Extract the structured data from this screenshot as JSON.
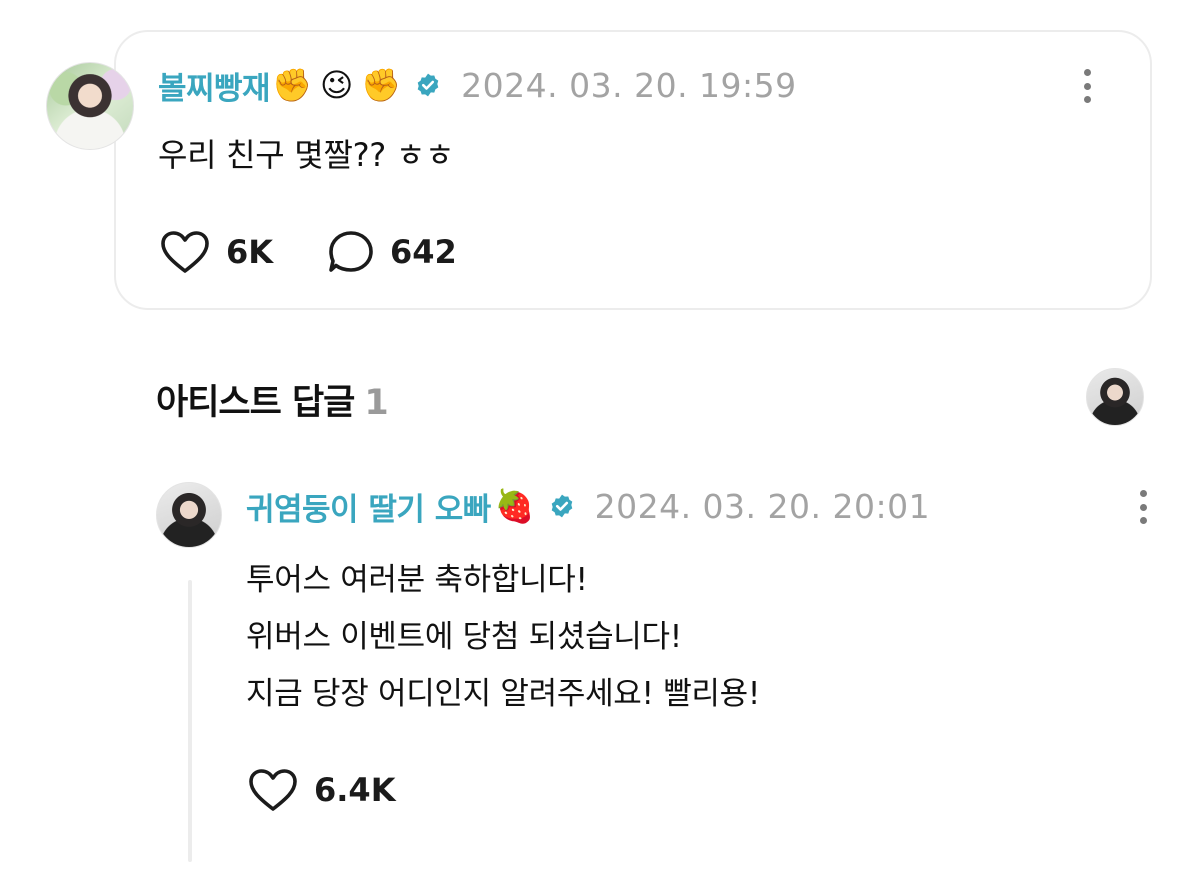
{
  "post": {
    "author_name": "볼찌빵재",
    "author_emojis": [
      "✊",
      "😉",
      "✊"
    ],
    "verified_icon": "verified-badge-icon",
    "timestamp": "2024. 03. 20. 19:59",
    "text": "우리 친구 몇짤?? ㅎㅎ",
    "likes": "6K",
    "comments": "642",
    "more_icon": "more-vertical-icon"
  },
  "section": {
    "title": "아티스트 답글",
    "count": "1"
  },
  "reply": {
    "author_name": "귀염둥이 딸기 오빠",
    "author_emoji": "🍓",
    "timestamp": "2024. 03. 20. 20:01",
    "lines": [
      "투어스 여러분 축하합니다!",
      "위버스 이벤트에 당첨 되셨습니다!",
      "지금 당장 어디인지 알려주세요! 빨리용!"
    ],
    "likes": "6.4K"
  },
  "colors": {
    "accent": "#3aa6bf",
    "timestamp": "#a3a3a3",
    "card_border": "#ececec"
  }
}
